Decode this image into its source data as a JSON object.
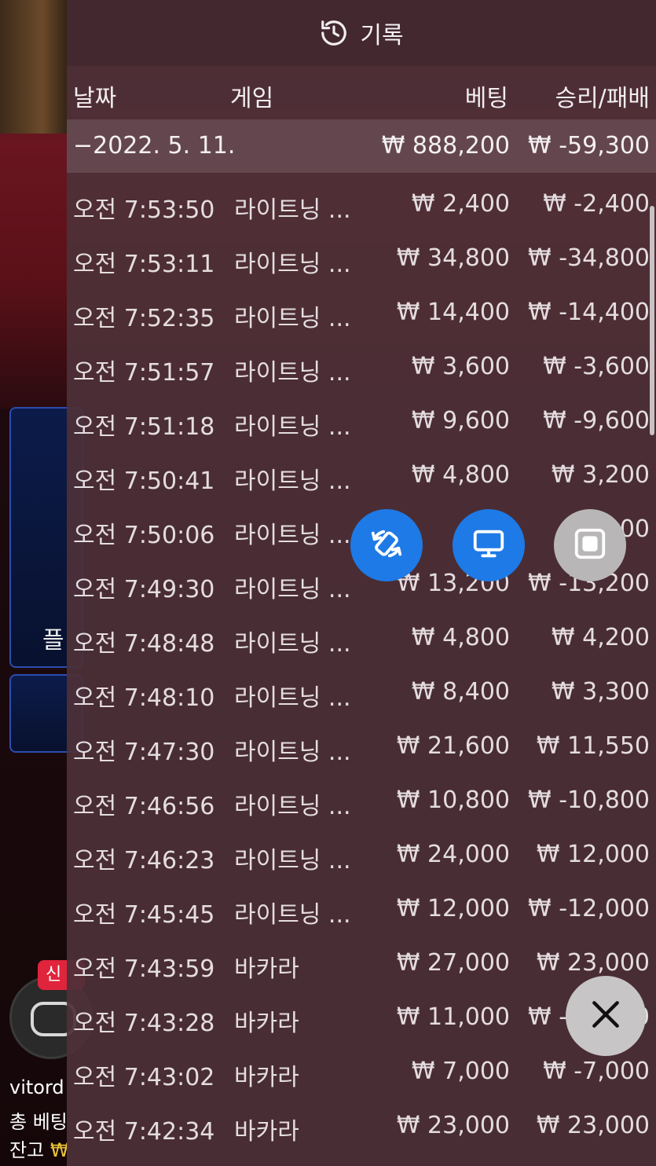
{
  "header": {
    "title": "기록",
    "icon": "history-icon"
  },
  "columns": {
    "date": "날짜",
    "game": "게임",
    "bet": "베팅",
    "result": "승리/패배"
  },
  "date_summary": {
    "date": "−2022. 5. 11.",
    "bet": "₩ 888,200",
    "result": "₩ -59,300"
  },
  "rows": [
    {
      "time": "오전 7:53:50",
      "game": "라이트닝 ...",
      "bet": "₩ 2,400",
      "result": "₩ -2,400"
    },
    {
      "time": "오전 7:53:11",
      "game": "라이트닝 ...",
      "bet": "₩ 34,800",
      "result": "₩ -34,800"
    },
    {
      "time": "오전 7:52:35",
      "game": "라이트닝 ...",
      "bet": "₩ 14,400",
      "result": "₩ -14,400"
    },
    {
      "time": "오전 7:51:57",
      "game": "라이트닝 ...",
      "bet": "₩ 3,600",
      "result": "₩ -3,600"
    },
    {
      "time": "오전 7:51:18",
      "game": "라이트닝 ...",
      "bet": "₩ 9,600",
      "result": "₩ -9,600"
    },
    {
      "time": "오전 7:50:41",
      "game": "라이트닝 ...",
      "bet": "₩ 4,800",
      "result": "₩ 3,200"
    },
    {
      "time": "오전 7:50:06",
      "game": "라이트닝 ...",
      "bet": "₩ 3",
      "result": "00"
    },
    {
      "time": "오전 7:49:30",
      "game": "라이트닝 ...",
      "bet": "₩ 13,200",
      "result": "₩ -13,200"
    },
    {
      "time": "오전 7:48:48",
      "game": "라이트닝 ...",
      "bet": "₩ 4,800",
      "result": "₩ 4,200"
    },
    {
      "time": "오전 7:48:10",
      "game": "라이트닝 ...",
      "bet": "₩ 8,400",
      "result": "₩ 3,300"
    },
    {
      "time": "오전 7:47:30",
      "game": "라이트닝 ...",
      "bet": "₩ 21,600",
      "result": "₩ 11,550"
    },
    {
      "time": "오전 7:46:56",
      "game": "라이트닝 ...",
      "bet": "₩ 10,800",
      "result": "₩ -10,800"
    },
    {
      "time": "오전 7:46:23",
      "game": "라이트닝 ...",
      "bet": "₩ 24,000",
      "result": "₩ 12,000"
    },
    {
      "time": "오전 7:45:45",
      "game": "라이트닝 ...",
      "bet": "₩ 12,000",
      "result": "₩ -12,000"
    },
    {
      "time": "오전 7:43:59",
      "game": "바카라",
      "bet": "₩ 27,000",
      "result": "₩ 23,000"
    },
    {
      "time": "오전 7:43:28",
      "game": "바카라",
      "bet": "₩ 11,000",
      "result": "₩ -11,000"
    },
    {
      "time": "오전 7:43:02",
      "game": "바카라",
      "bet": "₩ 7,000",
      "result": "₩ -7,000"
    },
    {
      "time": "오전 7:42:34",
      "game": "바카라",
      "bet": "₩ 23,000",
      "result": "₩ 23,000"
    }
  ],
  "background": {
    "new_badge": "신",
    "side_label": "플",
    "username": "vitord",
    "total_bet_label": "총 베팅",
    "balance_label": "잔고",
    "balance_coin": "₩"
  },
  "buttons": {
    "rotate": "rotate-icon",
    "screen": "monitor-icon",
    "stop": "stop-icon",
    "close": "close-icon"
  },
  "colors": {
    "accent_blue": "#1e7ae6",
    "panel_bg": "#4e3038",
    "coin_gold": "#e8c23a",
    "badge_red": "#e0243c"
  }
}
